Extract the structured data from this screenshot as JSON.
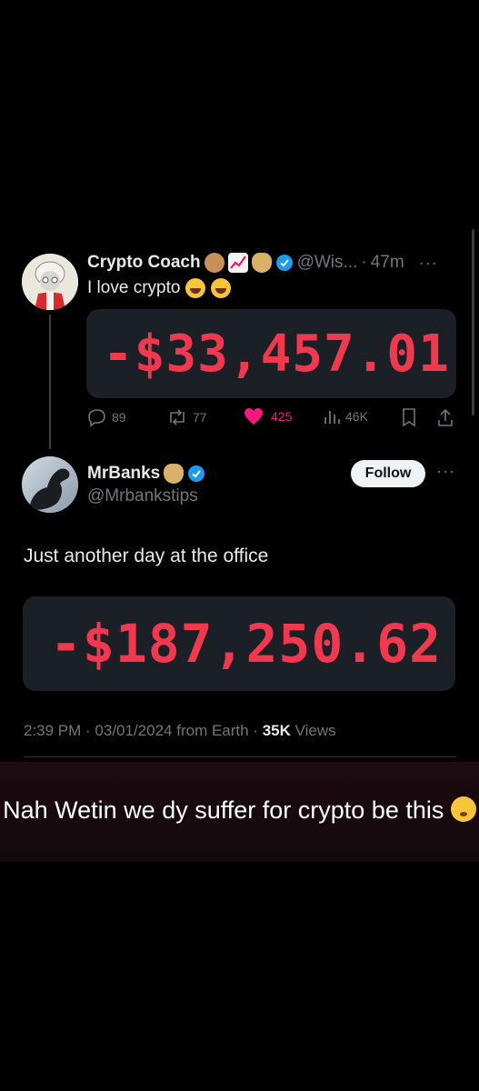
{
  "tweet1": {
    "name": "Crypto Coach",
    "handle": "@Wis...",
    "separator": "·",
    "time": "47m",
    "text": "I love crypto",
    "amount": "-$33,457.01",
    "stats": {
      "replies": "89",
      "retweets": "77",
      "likes": "425",
      "views": "46K"
    },
    "name_emojis": [
      "monkey-emoji",
      "chart-emoji",
      "money-bag-emoji"
    ],
    "text_emojis": [
      "laughing-emoji",
      "laughing-emoji"
    ]
  },
  "tweet2": {
    "name": "MrBanks",
    "handle": "@Mrbankstips",
    "follow_label": "Follow",
    "text": "Just another day at the office",
    "amount": "-$187,250.62",
    "meta_prefix": "2:39 PM · 03/01/2024 from Earth ·",
    "views_count": "35K",
    "views_label": "Views"
  },
  "caption": {
    "text": "Nah Wetin we dy suffer for crypto be this",
    "emoji": "sigh-face-emoji"
  },
  "colors": {
    "loss_red": "#f0384f",
    "verified_blue": "#1d9bf0",
    "like_pink": "#f91880",
    "muted": "#71767b"
  }
}
